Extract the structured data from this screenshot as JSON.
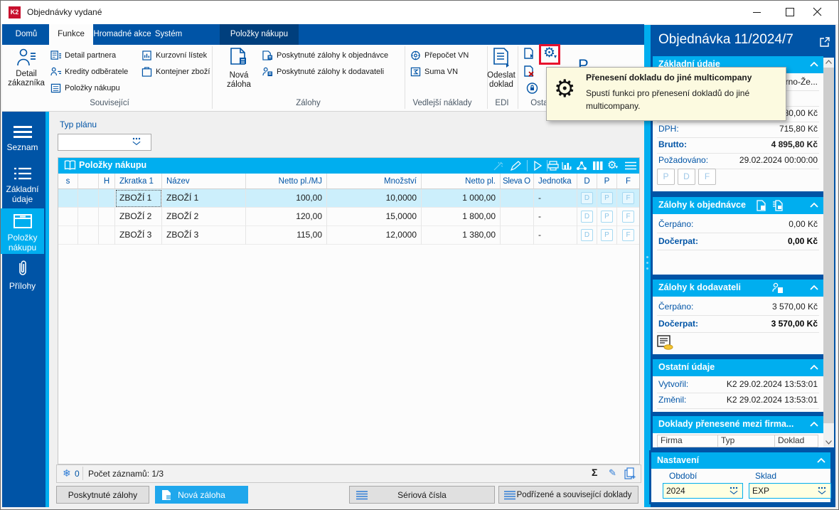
{
  "window": {
    "title": "Objednávky vydané"
  },
  "tabs": {
    "domu": "Domů",
    "funkce": "Funkce",
    "hromadne": "Hromadné akce",
    "system": "Systém",
    "polozky": "Položky nákupu"
  },
  "ribbon": {
    "souvisejici": {
      "label": "Související",
      "big_line1": "Detail",
      "big_line2": "zákazníka",
      "items": [
        "Detail partnera",
        "Kredity odběratele",
        "Položky nákupu",
        "Kurzovní lístek",
        "Kontejner zboží"
      ]
    },
    "zalohy": {
      "label": "Zálohy",
      "big_line1": "Nová",
      "big_line2": "záloha",
      "items": [
        "Poskytnuté zálohy k objednávce",
        "Poskytnuté zálohy k dodavateli"
      ]
    },
    "vedlejsi": {
      "label": "Vedlejší náklady",
      "items": [
        "Přepočet VN",
        "Suma VN"
      ]
    },
    "edi": {
      "label": "EDI",
      "big_line1": "Odeslat",
      "big_line2": "doklad"
    },
    "ostatni": {
      "label": "Ostat",
      "partial_letter": "P"
    }
  },
  "tooltip": {
    "title": "Přenesení dokladu do jiné multicompany",
    "line1": "Spustí funkci pro přenesení dokladů do jiné",
    "line2": "multicompany."
  },
  "sidebar": {
    "seznam": "Seznam",
    "zakladni1": "Základní",
    "zakladni2": "údaje",
    "polozky1": "Položky",
    "polozky2": "nákupu",
    "prilohy": "Přílohy"
  },
  "filter": {
    "label": "Typ plánu",
    "value": ""
  },
  "table": {
    "title": "Položky nákupu",
    "columns": [
      "s",
      "",
      "H",
      "Zkratka 1",
      "Název",
      "Netto pl./MJ",
      "Množství",
      "Netto pl.",
      "Sleva O",
      "Jednotka",
      "D",
      "P",
      "F"
    ],
    "rows": [
      {
        "zkratka": "ZBOŽÍ 1",
        "nazev": "ZBOŽÍ 1",
        "netto_mj": "100,00",
        "mnozstvi": "10,0000",
        "netto": "1 000,00",
        "sleva": "",
        "jednotka": "-",
        "d": "D",
        "p": "P",
        "f": "F"
      },
      {
        "zkratka": "ZBOŽÍ 2",
        "nazev": "ZBOŽÍ 2",
        "netto_mj": "120,00",
        "mnozstvi": "15,0000",
        "netto": "1 800,00",
        "sleva": "",
        "jednotka": "-",
        "d": "D",
        "p": "P",
        "f": "F"
      },
      {
        "zkratka": "ZBOŽÍ 3",
        "nazev": "ZBOŽÍ 3",
        "netto_mj": "115,00",
        "mnozstvi": "12,0000",
        "netto": "1 380,00",
        "sleva": "",
        "jednotka": "-",
        "d": "D",
        "p": "P",
        "f": "F"
      }
    ]
  },
  "status": {
    "frozen": "0",
    "count": "Počet záznamů: 1/3"
  },
  "actions": {
    "poskytnute": "Poskytnuté zálohy",
    "nova": "Nová záloha",
    "seriova": "Sériová čísla",
    "podrizene": "Podřízené a související doklady"
  },
  "panel": {
    "title": "Objednávka 11/2024/7",
    "basic": {
      "header": "Základní údaje",
      "row1_value": "rno-Že...",
      "row3_value": "80,00 Kč",
      "dph_label": "DPH:",
      "dph": "715,80 Kč",
      "brutto_label": "Brutto:",
      "brutto": "4 895,80 Kč",
      "pozadovano_label": "Požadováno:",
      "pozadovano": "29.02.2024 00:00:00",
      "flag_p": "P",
      "flag_d": "D",
      "flag_f": "F"
    },
    "zalohy_obj": {
      "header": "Zálohy k objednávce",
      "cerpano_label": "Čerpáno:",
      "cerpano": "0,00 Kč",
      "docerpat_label": "Dočerpat:",
      "docerpat": "0,00 Kč"
    },
    "zalohy_dod": {
      "header": "Zálohy k dodavateli",
      "cerpano_label": "Čerpáno:",
      "cerpano": "3 570,00 Kč",
      "docerpat_label": "Dočerpat:",
      "docerpat": "3 570,00 Kč"
    },
    "ostatni": {
      "header": "Ostatní údaje",
      "vytvoril_label": "Vytvořil:",
      "vytvoril": "K2 29.02.2024 13:53:01",
      "zmenil_label": "Změnil:",
      "zmenil": "K2 29.02.2024 13:53:01"
    },
    "doklady": {
      "header": "Doklady přenesené mezi firma...",
      "col1": "Firma",
      "col2": "Typ",
      "col3": "Doklad"
    },
    "nastaveni": {
      "header": "Nastavení",
      "obdobi_label": "Období",
      "obdobi": "2024",
      "sklad_label": "Sklad",
      "sklad": "EXP"
    }
  }
}
